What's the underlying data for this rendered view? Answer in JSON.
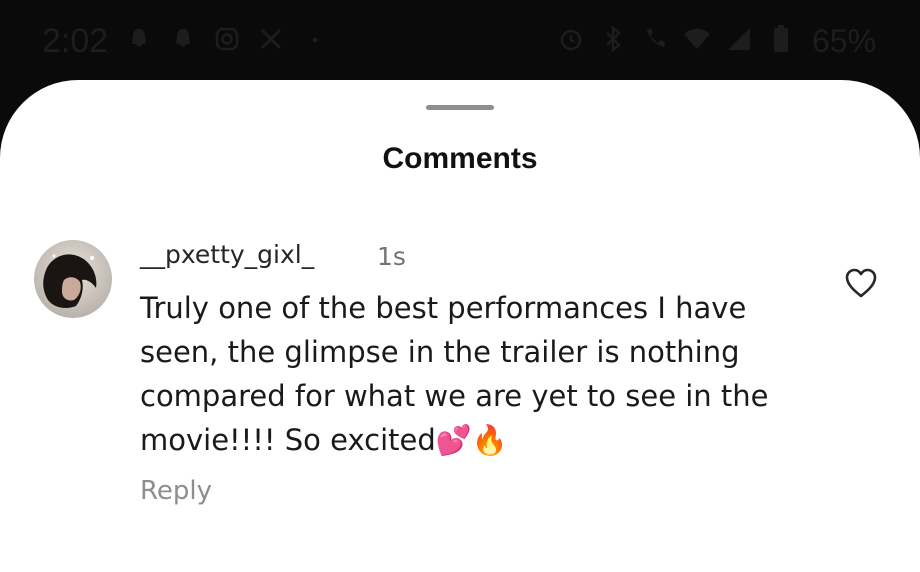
{
  "status_bar": {
    "time": "2:02",
    "left_icons": [
      "snapchat-icon",
      "snapchat-icon",
      "instagram-icon",
      "x-icon",
      "dot-icon"
    ],
    "right_icons": [
      "alarm-icon",
      "bluetooth-icon",
      "call-icon",
      "wifi-icon",
      "signal-icon",
      "battery-icon"
    ],
    "battery": "65%"
  },
  "sheet": {
    "title": "Comments"
  },
  "comment": {
    "username": "__pxetty_gixl_",
    "timestamp": "1s",
    "text": "Truly one of the best performances I have seen, the glimpse in the trailer is nothing compared for what we are yet to see in the movie!!!! So excited💕🔥",
    "reply_label": "Reply",
    "liked": false
  },
  "colors": {
    "sheet_bg": "#ffffff",
    "secondary_text": "#8e8e8e",
    "primary_text": "#1a1a1a"
  }
}
